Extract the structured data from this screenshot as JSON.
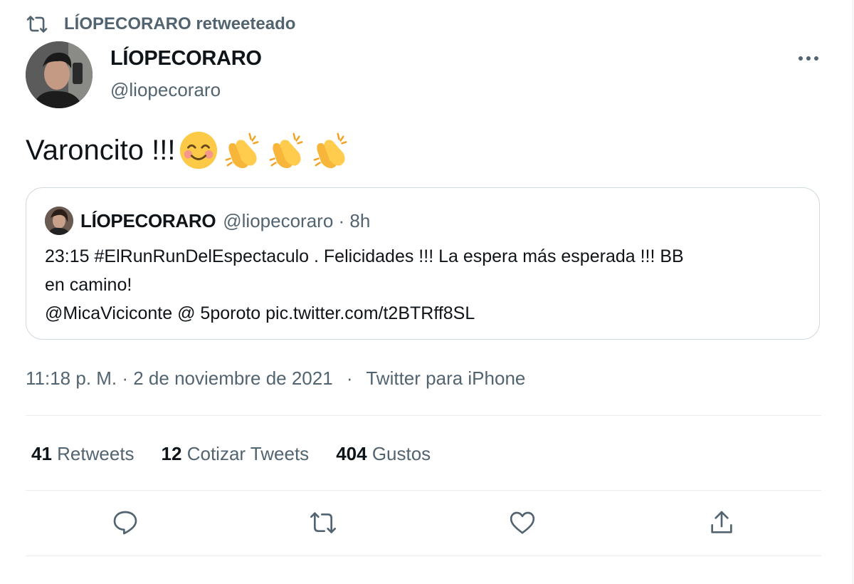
{
  "retweet_banner": {
    "text": "LÍOPECORARO retweeteado",
    "icon": "retweet-icon"
  },
  "tweet": {
    "author_name": "LÍOPECORARO",
    "author_handle": "@liopecoraro",
    "text": "Varoncito !!!",
    "emojis": [
      "smiling-face-icon",
      "clapping-hands-icon",
      "clapping-hands-icon",
      "clapping-hands-icon"
    ],
    "timestamp": "11:18 p. M. · 2 de noviembre de 2021",
    "separator": "·",
    "source": "Twitter para iPhone"
  },
  "quoted_tweet": {
    "author_name": "LÍOPECORARO",
    "meta": "@liopecoraro · 8h",
    "line1": "23:15 #ElRunRunDelEspectaculo . Felicidades !!! La espera más esperada !!! BB",
    "line2": "en camino!",
    "line3": "@MicaViciconte @ 5poroto  pic.twitter.com/t2BTRff8SL"
  },
  "stats": {
    "retweets_count": "41",
    "retweets_label": "Retweets",
    "quotes_count": "12",
    "quotes_label": "Cotizar Tweets",
    "likes_count": "404",
    "likes_label": "Gustos"
  },
  "colors": {
    "text": "#0f1419",
    "secondary": "#536471",
    "border": "#cfd9de",
    "divider": "#e6ecf0"
  }
}
